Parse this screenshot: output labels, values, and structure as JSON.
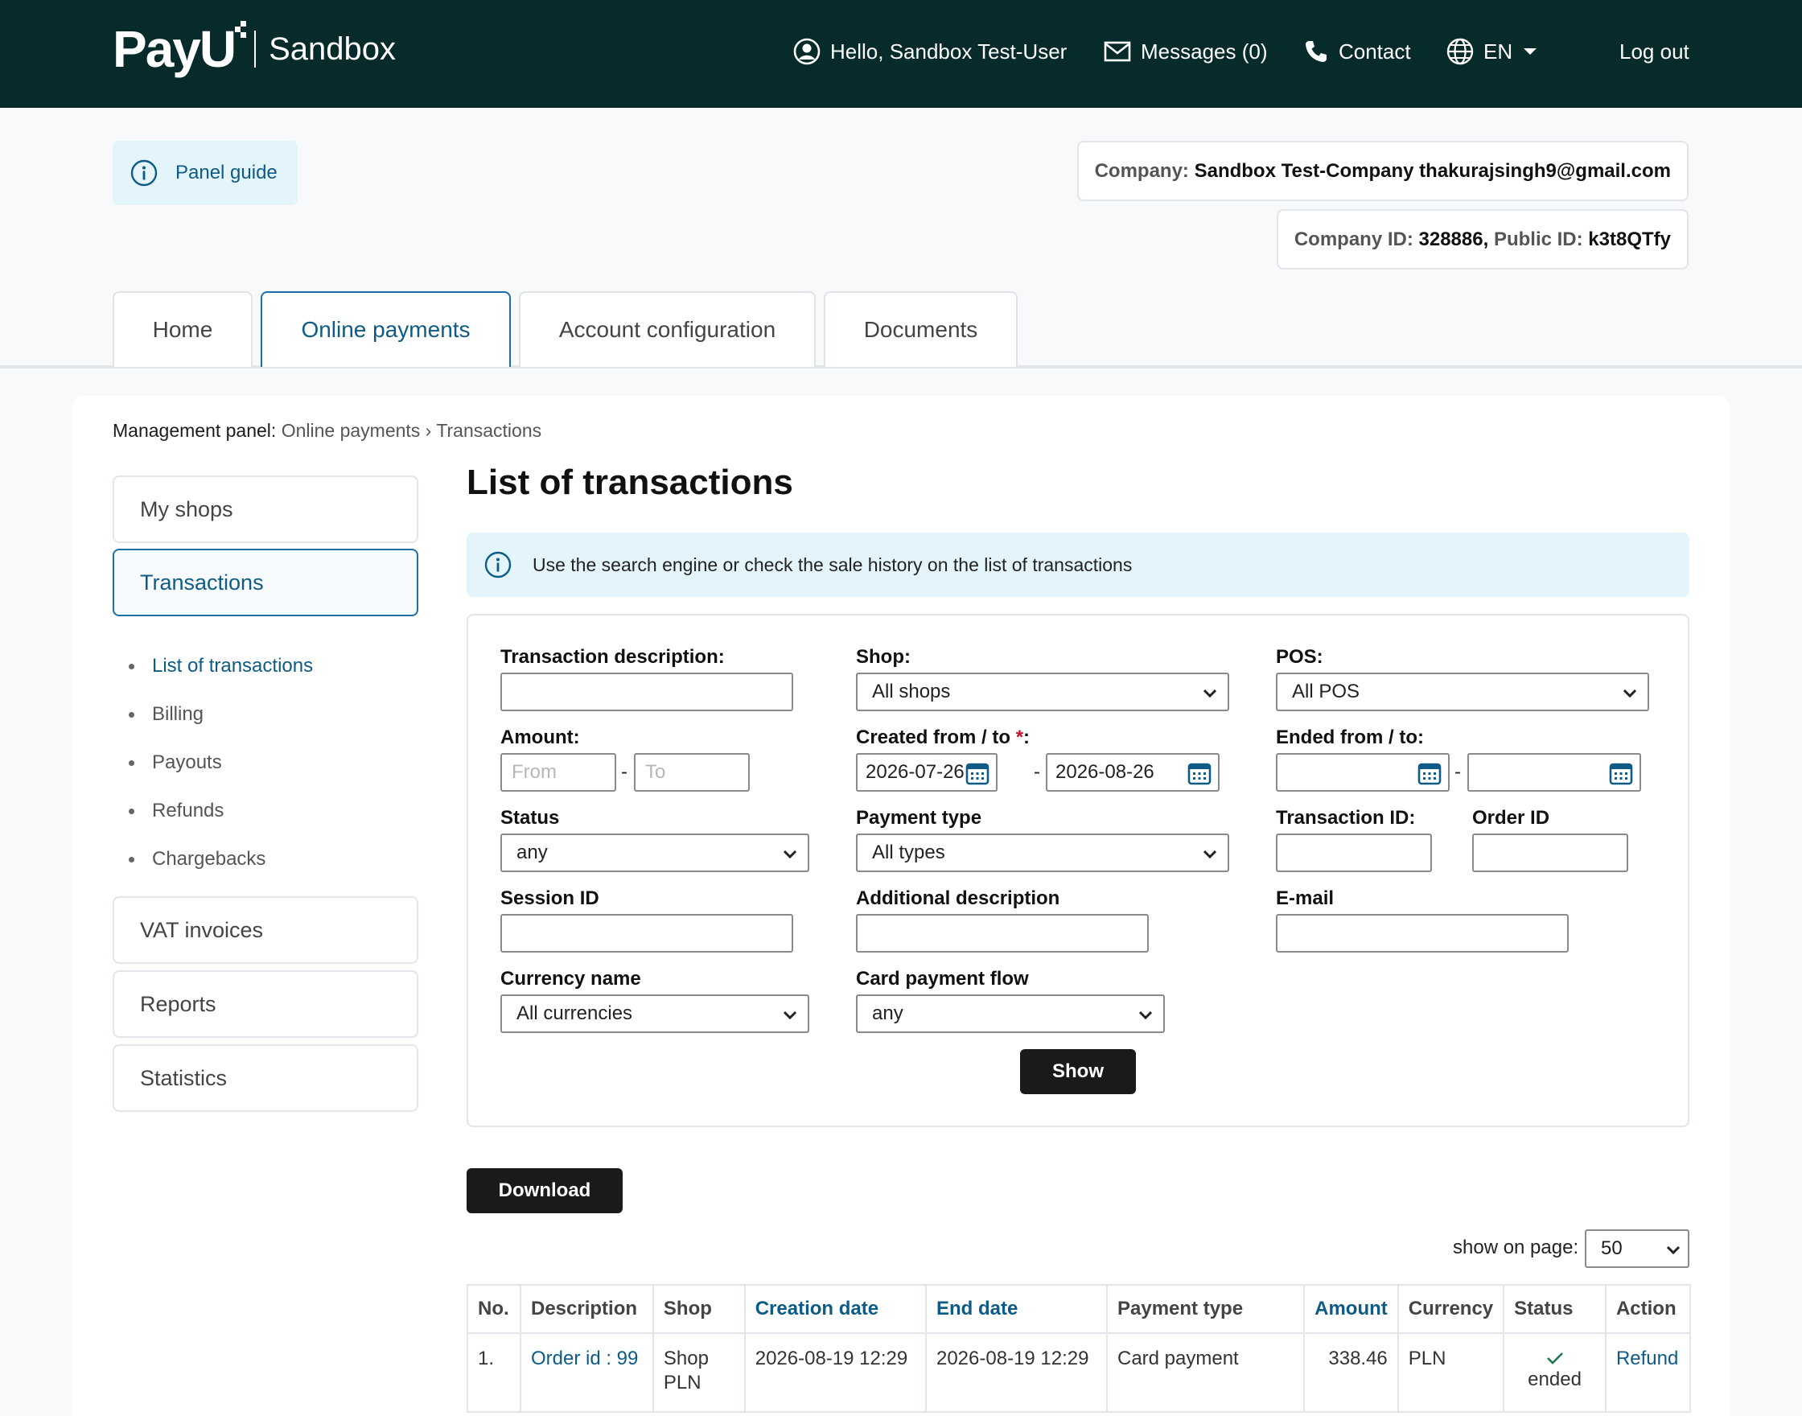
{
  "header": {
    "logo_text": "PayU",
    "logo_sub": "Sandbox",
    "greeting": "Hello, Sandbox Test-User",
    "messages": "Messages (0)",
    "contact": "Contact",
    "language": "EN",
    "logout": "Log out"
  },
  "panel_guide": {
    "label": "Panel guide"
  },
  "company": {
    "company_label": "Company:",
    "company_value": "Sandbox Test-Company thakurajsingh9@gmail.com",
    "company_id_label": "Company ID:",
    "company_id_value": "328886,",
    "public_id_label": "Public ID:",
    "public_id_value": "k3t8QTfy"
  },
  "tabs": [
    {
      "label": "Home"
    },
    {
      "label": "Online payments"
    },
    {
      "label": "Account configuration"
    },
    {
      "label": "Documents"
    }
  ],
  "breadcrumb": {
    "label": "Management panel:",
    "path": "Online payments › Transactions"
  },
  "sidebar": {
    "my_shops": "My shops",
    "transactions": "Transactions",
    "sub_items": [
      {
        "label": "List of transactions"
      },
      {
        "label": "Billing"
      },
      {
        "label": "Payouts"
      },
      {
        "label": "Refunds"
      },
      {
        "label": "Chargebacks"
      }
    ],
    "vat_invoices": "VAT invoices",
    "reports": "Reports",
    "statistics": "Statistics"
  },
  "main": {
    "title": "List of transactions",
    "info": "Use the search engine or check the sale history on the list of transactions"
  },
  "filters": {
    "transaction_description": {
      "label": "Transaction description:",
      "value": ""
    },
    "shop": {
      "label": "Shop:",
      "value": "All shops"
    },
    "pos": {
      "label": "POS:",
      "value": "All POS"
    },
    "amount": {
      "label": "Amount:",
      "from_placeholder": "From",
      "to_placeholder": "To"
    },
    "created": {
      "label": "Created from / to ",
      "required_mark": "*",
      "colon": ":",
      "from": "2026-07-26",
      "to": "2026-08-26"
    },
    "ended": {
      "label": "Ended from / to:",
      "from": "",
      "to": ""
    },
    "status": {
      "label": "Status",
      "value": "any"
    },
    "payment_type": {
      "label": "Payment type",
      "value": "All types"
    },
    "transaction_id": {
      "label": "Transaction ID:",
      "value": ""
    },
    "order_id": {
      "label": "Order ID",
      "value": ""
    },
    "session_id": {
      "label": "Session ID",
      "value": ""
    },
    "additional_description": {
      "label": "Additional description",
      "value": ""
    },
    "email": {
      "label": "E-mail",
      "value": ""
    },
    "currency_name": {
      "label": "Currency name",
      "value": "All currencies"
    },
    "card_payment_flow": {
      "label": "Card payment flow",
      "value": "any"
    },
    "show_button": "Show",
    "dash": "-"
  },
  "download_button": "Download",
  "pagination": {
    "label": "show on page:",
    "value": "50"
  },
  "table": {
    "headers": [
      "No.",
      "Description",
      "Shop",
      "Creation date",
      "End date",
      "Payment type",
      "Amount",
      "Currency",
      "Status",
      "Action"
    ],
    "rows": [
      {
        "no": "1.",
        "description": "Order id : 99",
        "shop": "Shop PLN",
        "creation_date": "2026-08-19 12:29",
        "end_date": "2026-08-19 12:29",
        "payment_type": "Card payment",
        "amount": "338.46",
        "currency": "PLN",
        "status": "ended",
        "action": "Refund"
      }
    ]
  },
  "colors": {
    "header_bg": "#072a2a",
    "accent_blue": "#0d5b86",
    "info_bg": "#e3f4fa",
    "button_dark": "#1a1a1a",
    "status_green": "#1e7a4a",
    "required_red": "#c8102e"
  }
}
